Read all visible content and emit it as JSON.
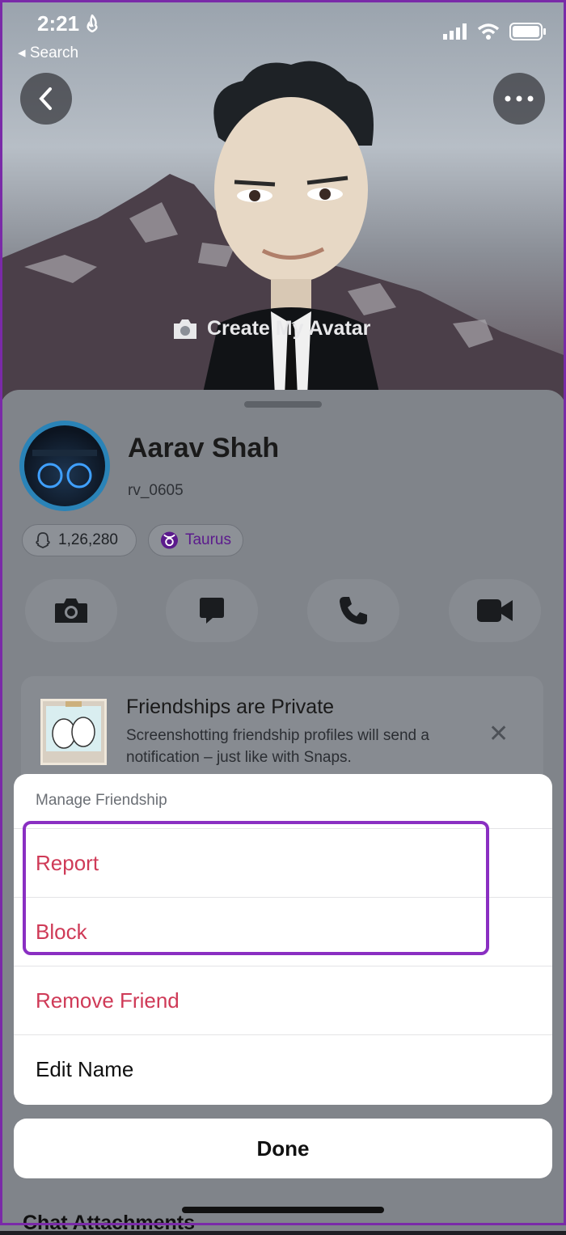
{
  "status_bar": {
    "time": "2:21",
    "back_label": "Search"
  },
  "header": {
    "create_avatar_label": "Create My Avatar"
  },
  "profile": {
    "name": "Aarav Shah",
    "username": "rv_0605",
    "snap_score": "1,26,280",
    "zodiac": "Taurus"
  },
  "notice": {
    "title": "Friendships are Private",
    "body": "Screenshotting friendship profiles will send a notification – just like with Snaps."
  },
  "action_sheet": {
    "title": "Manage Friendship",
    "items": [
      {
        "label": "Report"
      },
      {
        "label": "Block"
      },
      {
        "label": "Remove Friend"
      },
      {
        "label": "Edit Name"
      }
    ],
    "done_label": "Done"
  },
  "below_fold": {
    "peek_text": "Chat Attachments"
  },
  "colors": {
    "danger": "#cf3a57",
    "highlight": "#8a2fc2",
    "zodiac": "#5b1a8c",
    "ring": "#2a83b7"
  },
  "icons": [
    "fire-icon",
    "signal-icon",
    "wifi-icon",
    "battery-icon",
    "back-chevron-icon",
    "more-icon",
    "camera-icon",
    "chat-icon",
    "phone-icon",
    "video-icon",
    "snap-score-icon",
    "taurus-icon",
    "close-icon"
  ]
}
